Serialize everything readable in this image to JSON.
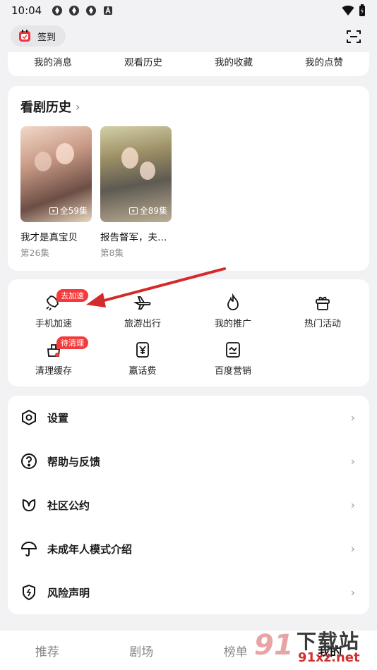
{
  "status_bar": {
    "time": "10:04"
  },
  "header": {
    "checkin_label": "签到"
  },
  "quick_links": [
    "我的消息",
    "观看历史",
    "我的收藏",
    "我的点赞"
  ],
  "history": {
    "title": "看剧历史",
    "items": [
      {
        "name": "我才是真宝贝",
        "progress": "第26集",
        "total": "全59集"
      },
      {
        "name": "报告督军，夫…",
        "progress": "第8集",
        "total": "全89集"
      }
    ]
  },
  "tools": [
    {
      "label": "手机加速",
      "icon": "rocket-icon",
      "badge": "去加速"
    },
    {
      "label": "旅游出行",
      "icon": "airplane-icon"
    },
    {
      "label": "我的推广",
      "icon": "flame-icon"
    },
    {
      "label": "热门活动",
      "icon": "gift-icon"
    },
    {
      "label": "清理缓存",
      "icon": "broom-icon",
      "badge": "待清理"
    },
    {
      "label": "赢话费",
      "icon": "yen-icon"
    },
    {
      "label": "百度营销",
      "icon": "chart-icon"
    }
  ],
  "settings": [
    {
      "label": "设置",
      "icon": "hex-gear-icon"
    },
    {
      "label": "帮助与反馈",
      "icon": "help-icon"
    },
    {
      "label": "社区公约",
      "icon": "leaf-icon"
    },
    {
      "label": "未成年人模式介绍",
      "icon": "umbrella-icon"
    },
    {
      "label": "风险声明",
      "icon": "shield-icon"
    }
  ],
  "tabbar": [
    {
      "label": "推荐",
      "active": false
    },
    {
      "label": "剧场",
      "active": false
    },
    {
      "label": "榜单",
      "active": false
    },
    {
      "label": "我的",
      "active": true
    }
  ],
  "watermark": {
    "number": "91",
    "title": "下载站",
    "url": "91xz.net"
  },
  "colors": {
    "badge": "#f43a3a",
    "annotation_arrow": "#d42a2a"
  }
}
